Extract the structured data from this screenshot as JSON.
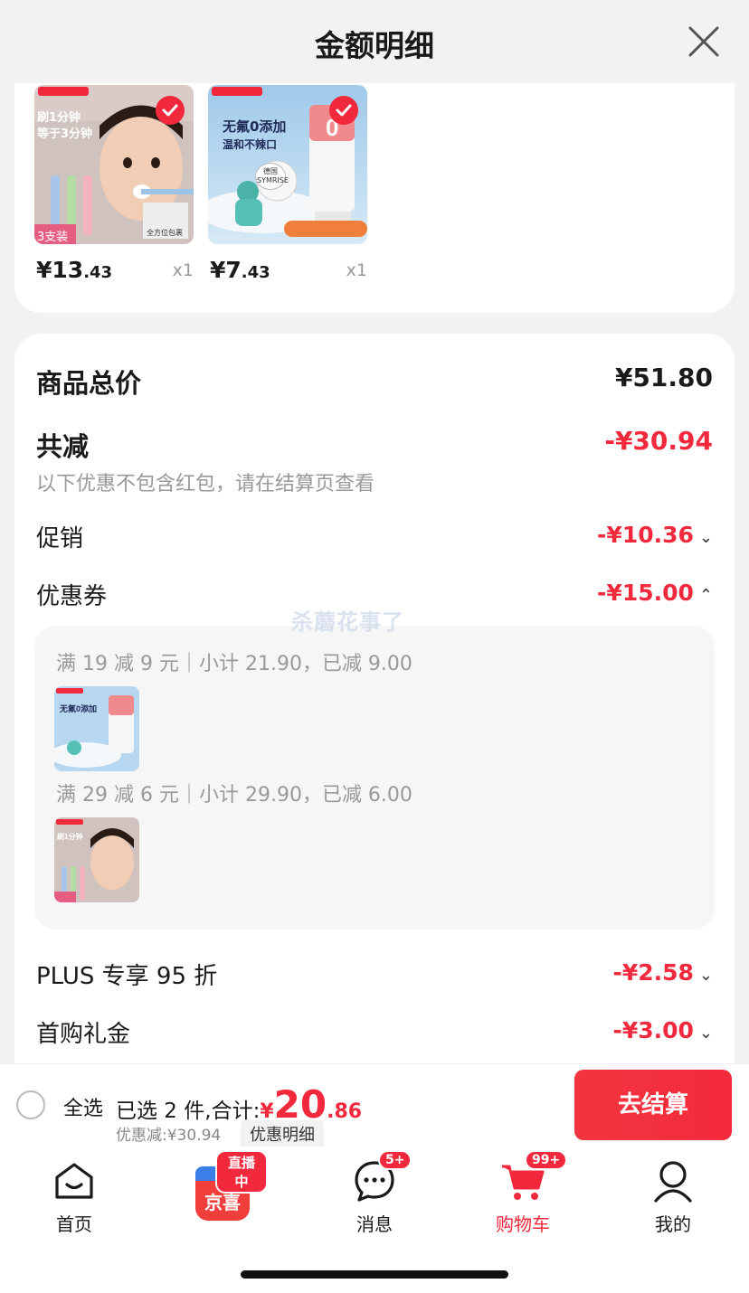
{
  "header": {
    "title": "金额明细",
    "close_icon": "close-icon"
  },
  "products": [
    {
      "price_main": "¥13",
      "price_dec": ".43",
      "qty": "x1",
      "img_text_1": "刷1分钟",
      "img_text_2": "等于3分钟",
      "img_tag": "3支装",
      "img_caption": "全方位包裹"
    },
    {
      "price_main": "¥7",
      "price_dec": ".43",
      "qty": "x1",
      "img_text_1": "无氟0添加",
      "img_text_2": "温和不辣口",
      "img_tag": "德国 SYMRISE"
    }
  ],
  "summary": {
    "total_label": "商品总价",
    "total_value": "¥51.80",
    "reduce_label": "共减",
    "reduce_value": "-¥30.94",
    "note": "以下优惠不包含红包，请在结算页查看",
    "promo_label": "促销",
    "promo_value": "-¥10.36",
    "coupon_label": "优惠券",
    "coupon_value": "-¥15.00",
    "plus_label": "PLUS 专享 95 折",
    "plus_value": "-¥2.58",
    "gift_label": "首购礼金",
    "gift_value": "-¥3.00"
  },
  "coupons": [
    {
      "text": "满 19 减 9 元｜小计 21.90，已减 9.00"
    },
    {
      "text": "满 29 减 6 元｜小计 29.90，已减 6.00"
    }
  ],
  "watermark": "杀蘑花事了",
  "checkout": {
    "select_all": "全选",
    "selected_prefix": "已选 2 件,合计:",
    "currency": "¥",
    "amount_int": "20",
    "amount_dec": ".86",
    "discount_text": "优惠减:¥30.94",
    "detail_label": "优惠明细",
    "pay_label": "去结算"
  },
  "tabbar": {
    "home": "首页",
    "live_badge": "直播中",
    "live_label": "京喜",
    "messages": "消息",
    "messages_badge": "5+",
    "cart": "购物车",
    "cart_badge": "99+",
    "mine": "我的"
  },
  "colors": {
    "accent": "#f2293c",
    "background": "#f2f2f2"
  }
}
